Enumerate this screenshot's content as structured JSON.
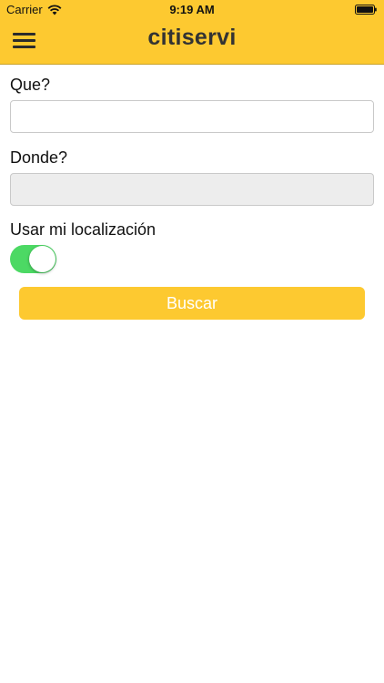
{
  "status_bar": {
    "carrier": "Carrier",
    "time": "9:19 AM",
    "icons": [
      "wifi-icon",
      "battery-icon"
    ]
  },
  "header": {
    "title": "citiservi",
    "menu_icon": "hamburger-menu-icon",
    "background_color": "#fdc930"
  },
  "form": {
    "que_label": "Que?",
    "que_value": "",
    "donde_label": "Donde?",
    "donde_value": "",
    "location_label": "Usar mi localización",
    "use_location": true,
    "search_button": "Buscar"
  },
  "colors": {
    "accent": "#fdc930",
    "toggle_on": "#4cd964"
  }
}
